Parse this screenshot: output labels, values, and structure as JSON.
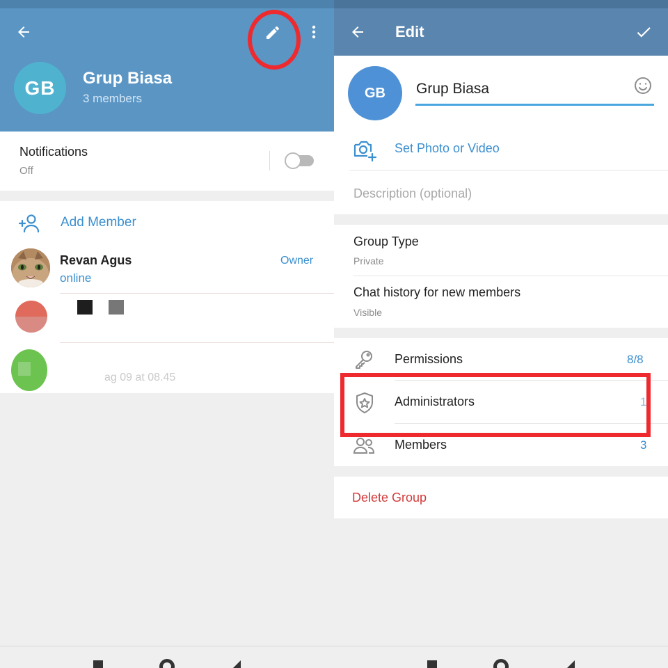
{
  "left_screen": {
    "header": {
      "group_initials": "GB",
      "group_name": "Grup Biasa",
      "member_count": "3 members"
    },
    "notifications": {
      "title": "Notifications",
      "status": "Off",
      "enabled": false
    },
    "add_member_label": "Add Member",
    "members": [
      {
        "name": "Revan Agus",
        "status": "online",
        "role": "Owner"
      },
      {
        "name": "",
        "status": ""
      },
      {
        "name": "",
        "status": "ag 09 at 08.45"
      }
    ]
  },
  "right_screen": {
    "header": {
      "title": "Edit"
    },
    "group_initials": "GB",
    "group_name_value": "Grup Biasa",
    "set_photo_label": "Set Photo or Video",
    "description_placeholder": "Description (optional)",
    "group_type": {
      "title": "Group Type",
      "value": "Private"
    },
    "chat_history": {
      "title": "Chat history for new members",
      "value": "Visible"
    },
    "permissions": {
      "label": "Permissions",
      "value": "8/8"
    },
    "administrators": {
      "label": "Administrators",
      "value": "1"
    },
    "members": {
      "label": "Members",
      "value": "3"
    },
    "delete_group_label": "Delete Group"
  },
  "colors": {
    "header_blue": "#5a95c4",
    "accent_blue": "#3b8fd0",
    "highlight_red": "#ee2a2f",
    "danger_red": "#d23b3b"
  }
}
